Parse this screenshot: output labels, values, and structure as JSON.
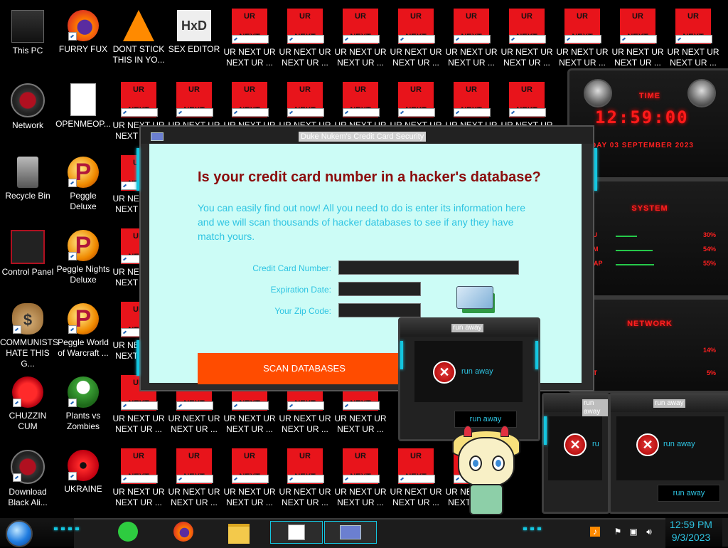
{
  "desktop": {
    "icons_left": [
      {
        "label": "This PC",
        "icon": "computer-icon"
      },
      {
        "label": "FURRY FUX",
        "icon": "firefox-icon"
      },
      {
        "label": "DONT STICK THIS IN YO...",
        "icon": "vlc-icon"
      },
      {
        "label": "SEX EDITOR",
        "icon": "hex-editor-icon"
      },
      {
        "label": "Network",
        "icon": "network-icon"
      },
      {
        "label": "OPENMEOP...",
        "icon": "document-icon"
      },
      {
        "label": "Recycle Bin",
        "icon": "recycle-bin-icon"
      },
      {
        "label": "Peggle Deluxe",
        "icon": "peggle-icon"
      },
      {
        "label": "Control Panel",
        "icon": "control-panel-icon"
      },
      {
        "label": "Peggle Nights Deluxe",
        "icon": "peggle-icon"
      },
      {
        "label": "COMMUNISTS HATE THIS G...",
        "icon": "money-bag-icon"
      },
      {
        "label": "Peggle World of Warcraft ...",
        "icon": "peggle-icon"
      },
      {
        "label": "CHUZZIN CUM",
        "icon": "chuzzle-icon"
      },
      {
        "label": "Plants vs Zombies",
        "icon": "plant-icon"
      },
      {
        "label": "Download Black Ali...",
        "icon": "alien-icon"
      },
      {
        "label": "UKRAINE",
        "icon": "radiation-icon"
      }
    ],
    "ur_icon": {
      "top": "UR",
      "bottom": "NEXT",
      "label": "UR NEXT UR NEXT UR ..."
    },
    "partial_label": "UR NEXT UR NEXT UR ...",
    "partial_ur": "UR",
    "partial_next": "NEXT"
  },
  "gadgets": {
    "time_title": "TIME",
    "time_value": "12:59:00",
    "date_value": "DAY 03 SEPTEMBER 2023",
    "system_title": "SYSTEM",
    "cpu_label": "CPU",
    "cpu_value": "30%",
    "ram_label": "RAM",
    "ram_value": "54%",
    "swap_label": "SWAP",
    "swap_value": "55%",
    "network_title": "NETWORK",
    "net_in_value": "14%",
    "net_out_label": "OUT",
    "net_out_value": "5%"
  },
  "dialog": {
    "title": "Duke Nukem's Credit Card Security",
    "question": "Is your credit card number in a hacker's database?",
    "description": "You can easily find out now! All you need to do is enter its information here and we will scan thousands of hacker databases to see if any they have match yours.",
    "card_number_label": "Credit Card Number:",
    "expiration_label": "Expiration Date:",
    "zip_label": "Your Zip Code:",
    "card_number_value": "",
    "expiration_value": "",
    "zip_value": "",
    "scan_button": "SCAN DATABASES"
  },
  "runaway": {
    "title": "run away",
    "message": "run away",
    "button": "run away",
    "partial_message": "ru"
  },
  "taskbar": {
    "time": "12:59 PM",
    "date": "9/3/2023",
    "apps": [
      "notes-icon",
      "firefox-icon",
      "file-explorer-icon",
      "window-app-icon",
      "window-app-icon"
    ]
  },
  "colors": {
    "accent_cyan": "#2ec4e2",
    "dialog_bg": "#ccfcf6",
    "question_red": "#8b0d0d",
    "scan_orange": "#ff4c00",
    "ur_red": "#e8141b"
  }
}
